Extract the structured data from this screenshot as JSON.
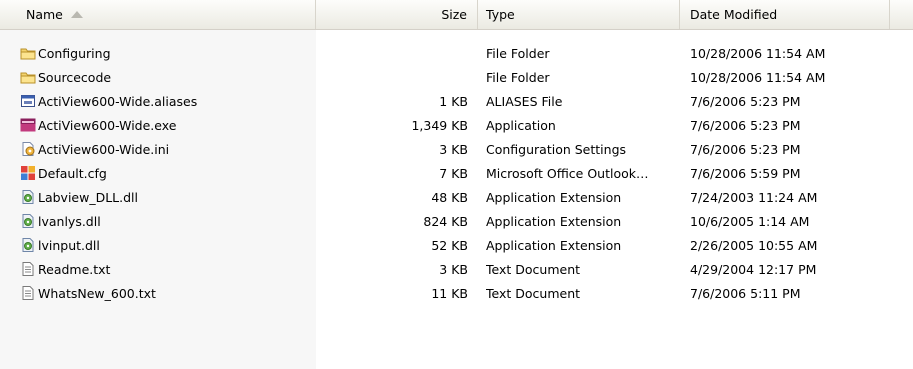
{
  "columns": {
    "name": "Name",
    "size": "Size",
    "type": "Type",
    "date": "Date Modified"
  },
  "rows": [
    {
      "icon": "folder-icon",
      "name": "Configuring",
      "size": "",
      "type": "File Folder",
      "date": "10/28/2006 11:54 AM"
    },
    {
      "icon": "folder-icon",
      "name": "Sourcecode",
      "size": "",
      "type": "File Folder",
      "date": "10/28/2006 11:54 AM"
    },
    {
      "icon": "aliases-file-icon",
      "name": "ActiView600-Wide.aliases",
      "size": "1 KB",
      "type": "ALIASES File",
      "date": "7/6/2006 5:23 PM"
    },
    {
      "icon": "application-icon",
      "name": "ActiView600-Wide.exe",
      "size": "1,349 KB",
      "type": "Application",
      "date": "7/6/2006 5:23 PM"
    },
    {
      "icon": "settings-file-icon",
      "name": "ActiView600-Wide.ini",
      "size": "3 KB",
      "type": "Configuration Settings",
      "date": "7/6/2006 5:23 PM"
    },
    {
      "icon": "outlook-file-icon",
      "name": "Default.cfg",
      "size": "7 KB",
      "type": "Microsoft Office Outlook…",
      "date": "7/6/2006 5:59 PM"
    },
    {
      "icon": "dll-file-icon",
      "name": "Labview_DLL.dll",
      "size": "48 KB",
      "type": "Application Extension",
      "date": "7/24/2003 11:24 AM"
    },
    {
      "icon": "dll-file-icon",
      "name": "lvanlys.dll",
      "size": "824 KB",
      "type": "Application Extension",
      "date": "10/6/2005 1:14 AM"
    },
    {
      "icon": "dll-file-icon",
      "name": "lvinput.dll",
      "size": "52 KB",
      "type": "Application Extension",
      "date": "2/26/2005 10:55 AM"
    },
    {
      "icon": "text-file-icon",
      "name": "Readme.txt",
      "size": "3 KB",
      "type": "Text Document",
      "date": "4/29/2004 12:17 PM"
    },
    {
      "icon": "text-file-icon",
      "name": "WhatsNew_600.txt",
      "size": "11 KB",
      "type": "Text Document",
      "date": "7/6/2006 5:11 PM"
    }
  ]
}
